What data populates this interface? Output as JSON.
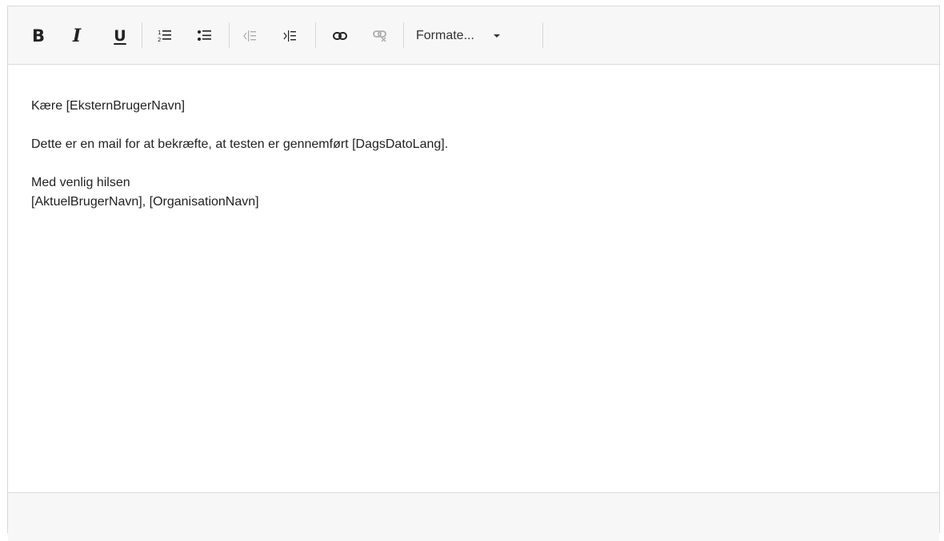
{
  "toolbar": {
    "bold_label": "B",
    "italic_label": "I",
    "underline_label": "U",
    "format_label": "Formate...",
    "icons": [
      "bold-icon",
      "italic-icon",
      "underline-icon",
      "numbered-list-icon",
      "bullet-list-icon",
      "outdent-icon",
      "indent-icon",
      "link-icon",
      "unlink-icon",
      "chevron-down-icon"
    ]
  },
  "content": {
    "greeting": "Kære [EksternBrugerNavn]",
    "body": "Dette er en mail for at bekræfte, at testen er gennemført [DagsDatoLang].",
    "closing": "Med venlig hilsen",
    "signature": "[AktuelBrugerNavn], [OrganisationNavn]"
  },
  "colors": {
    "toolbar_bg": "#f7f7f7",
    "border": "#d9d9d9",
    "text": "#222222"
  }
}
